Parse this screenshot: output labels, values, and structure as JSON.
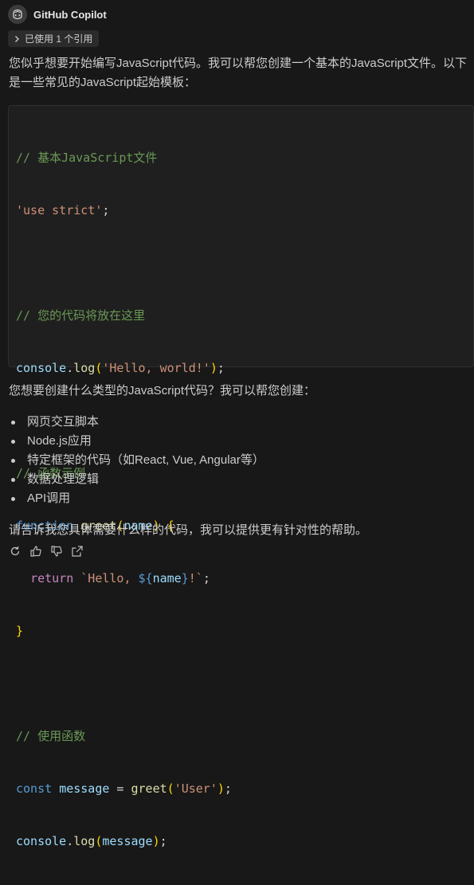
{
  "author": {
    "name": "GitHub Copilot",
    "icon": "copilot-icon"
  },
  "references": {
    "label": "已使用 1 个引用",
    "icon": "chevron-right-icon"
  },
  "intro": "您似乎想要开始编写JavaScript代码。我可以帮您创建一个基本的JavaScript文件。以下是一些常见的JavaScript起始模板：",
  "code": {
    "language": "javascript",
    "lines": [
      "// 基本JavaScript文件",
      "'use strict';",
      "",
      "// 您的代码将放在这里",
      "console.log('Hello, world!');",
      "",
      "// 函数示例",
      "function greet(name) {",
      "  return `Hello, ${name}!`;",
      "}",
      "",
      "// 使用函数",
      "const message = greet('User');",
      "console.log(message);"
    ]
  },
  "question": "您想要创建什么类型的JavaScript代码？我可以帮您创建：",
  "options": [
    "网页交互脚本",
    "Node.js应用",
    "特定框架的代码（如React, Vue, Angular等）",
    "数据处理逻辑",
    "API调用"
  ],
  "closing": "请告诉我您具体需要什么样的代码，我可以提供更有针对性的帮助。",
  "actions": [
    "retry-icon",
    "thumbs-up-icon",
    "thumbs-down-icon",
    "insert-icon"
  ],
  "colors": {
    "background": "#181818",
    "code_background": "#1f1f1f",
    "comment": "#6a9955",
    "string": "#ce9178",
    "keyword": "#569cd6",
    "function": "#dcdcaa",
    "variable": "#9cdcfe"
  }
}
